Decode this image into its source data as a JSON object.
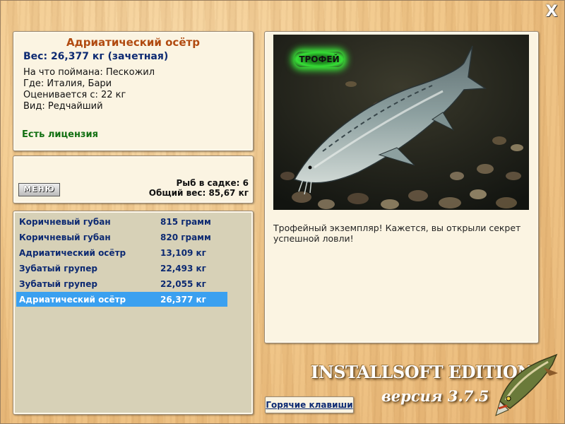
{
  "window": {
    "close_symbol": "X"
  },
  "fish_info": {
    "title": "Адриатический осётр",
    "weight": "Вес: 26,377 кг (зачетная)",
    "bait": "На что поймана: Пескожил",
    "location": "Где: Италия, Бари",
    "rated_from": "Оценивается с: 22 кг",
    "rarity": "Вид: Редчайший",
    "license": "Есть лицензия"
  },
  "keepnet": {
    "menu_label": "МЕНЮ",
    "fish_count": "Рыб в садке: 6",
    "total_weight": "Общий вес: 85,67 кг"
  },
  "catch_list": [
    {
      "name": "Коричневый губан",
      "weight": "815 грамм"
    },
    {
      "name": "Коричневый губан",
      "weight": "820 грамм"
    },
    {
      "name": "Адриатический осётр",
      "weight": "13,109 кг"
    },
    {
      "name": "Зубатый групер",
      "weight": "22,493 кг"
    },
    {
      "name": "Зубатый групер",
      "weight": "22,055 кг"
    },
    {
      "name": "Адриатический осётр",
      "weight": "26,377 кг",
      "selected": true
    }
  ],
  "photo": {
    "badge": "ТРОФЕЙ",
    "description": "Трофейный экземпляр! Кажется, вы открыли секрет успешной ловли!"
  },
  "branding": {
    "edition": "INSTALLSOFT EDITION",
    "version": "версия 3.7.5"
  },
  "hotkeys_label": "Горячие клавиши",
  "colors": {
    "selection": "#3aa0f0",
    "title": "#b14a10",
    "license": "#127012",
    "text_blue": "#0d2a72"
  }
}
